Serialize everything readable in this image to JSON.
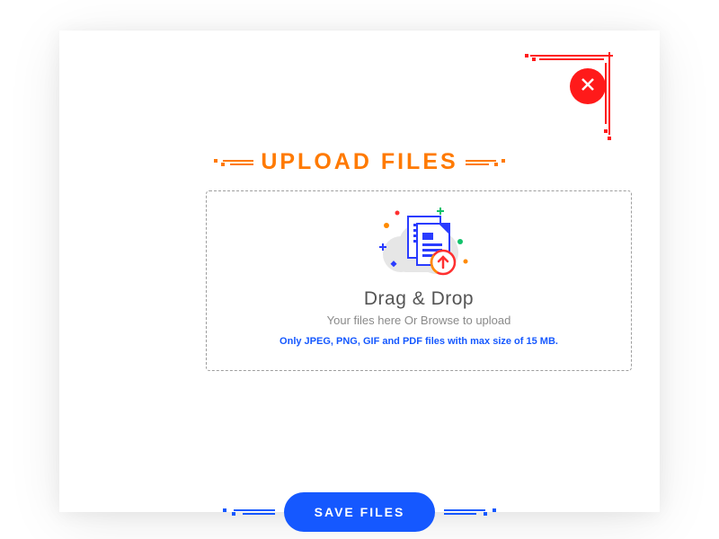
{
  "modal": {
    "title": "UPLOAD FILES",
    "close_icon": "close"
  },
  "dropzone": {
    "heading": "Drag & Drop",
    "subheading": "Your files here Or Browse to upload",
    "hint": "Only JPEG, PNG, GIF and PDF files with max size of 15 MB."
  },
  "actions": {
    "save_label": "SAVE FILES"
  },
  "colors": {
    "accent_orange": "#ff7a00",
    "accent_blue": "#1558ff",
    "accent_red": "#ff1a1a"
  }
}
